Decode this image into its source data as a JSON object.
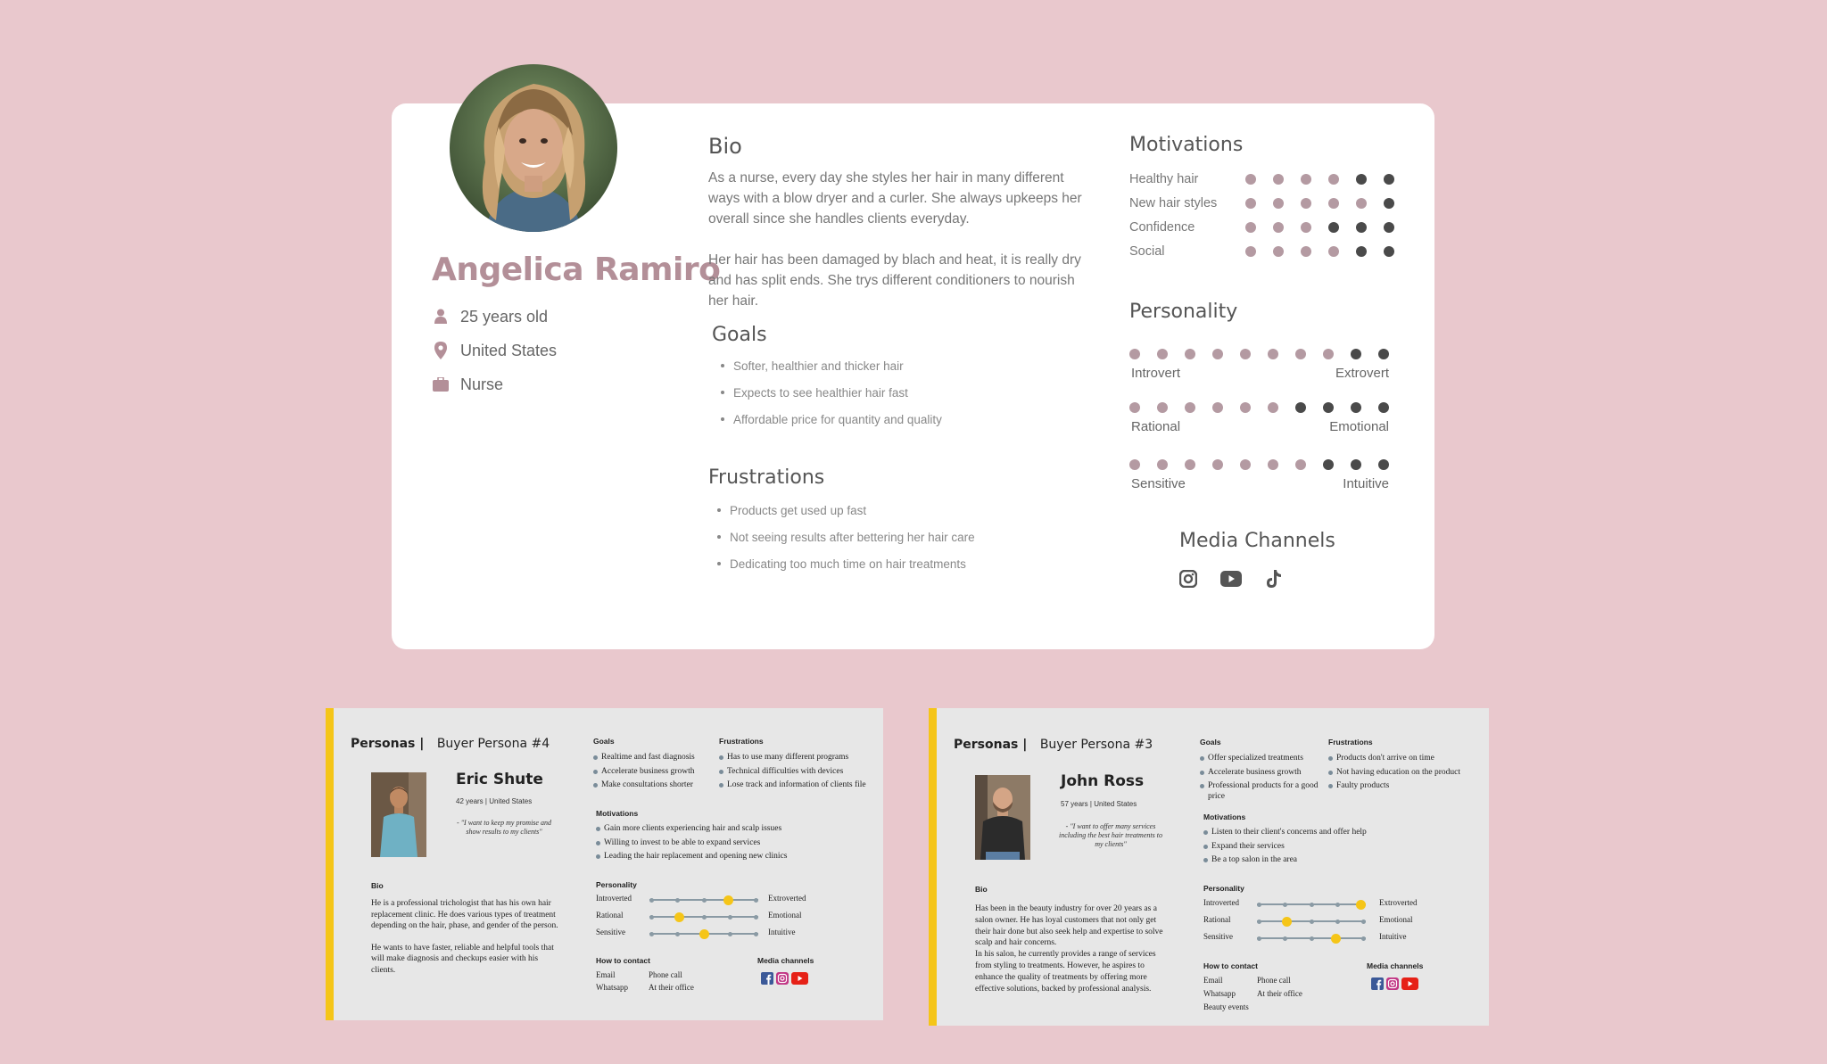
{
  "persona": {
    "name": "Angelica Ramiro",
    "age": "25 years old",
    "location": "United States",
    "job": "Nurse",
    "bio_title": "Bio",
    "bio_p1": "As a nurse, every day she styles her hair in many different ways with a blow dryer and a curler. She always upkeeps her overall since she handles clients everyday.",
    "bio_p2": "Her hair has been damaged by blach and heat, it is really dry and has split ends. She trys different conditioners to nourish her hair.",
    "goals_title": "Goals",
    "goals": [
      "Softer, healthier and thicker hair",
      "Expects to see healthier hair fast",
      "Affordable price for quantity and quality"
    ],
    "frustrations_title": "Frustrations",
    "frustrations": [
      "Products get used up fast",
      "Not seeing results after bettering her hair care",
      "Dedicating too much time on hair treatments"
    ],
    "motivations_title": "Motivations",
    "motivations": [
      {
        "label": "Healthy hair",
        "level": 4
      },
      {
        "label": "New hair styles",
        "level": 5
      },
      {
        "label": "Confidence",
        "level": 3
      },
      {
        "label": "Social",
        "level": 4
      }
    ],
    "personality_title": "Personality",
    "personality": [
      {
        "left": "Introvert",
        "right": "Extrovert",
        "light_dots": 8
      },
      {
        "left": "Rational",
        "right": "Emotional",
        "light_dots": 6
      },
      {
        "left": "Sensitive",
        "right": "Intuitive",
        "light_dots": 7
      }
    ],
    "media_title": "Media Channels",
    "media_icons": [
      "instagram-icon",
      "youtube-icon",
      "tiktok-icon"
    ],
    "colors": {
      "accent": "#b38f98",
      "dot_light": "#b49aa2",
      "dot_dark": "#4a4a4a",
      "background": "#e9c8cd"
    }
  },
  "slides": [
    {
      "brand": "Personas |",
      "subtitle": "Buyer Persona #4",
      "name": "Eric Shute",
      "meta": "42 years | United States",
      "quote": "- \"I want to keep my promise and show results to my clients\"",
      "goals_title": "Goals",
      "goals": [
        "Realtime and fast diagnosis",
        "Accelerate business growth",
        "Make consultations shorter"
      ],
      "frustrations_title": "Frustrations",
      "frustrations": [
        "Has to use many different programs",
        "Technical difficulties with devices",
        "Lose track and information of clients file"
      ],
      "motivations_title": "Motivations",
      "motivations": [
        "Gain more clients experiencing hair and scalp issues",
        "Willing to invest to be able to expand services",
        "Leading the hair replacement and opening new clinics"
      ],
      "bio_title": "Bio",
      "bio_p1": "He is a professional trichologist that has his own hair replacement clinic. He does various types of treatment depending on the hair, phase, and gender of the person.",
      "bio_p2": "He wants to have faster, reliable and helpful tools that will make diagnosis and checkups easier with his clients.",
      "personality_title": "Personality",
      "personality": [
        {
          "left": "Introverted",
          "right": "Extroverted",
          "value": 0.75
        },
        {
          "left": "Rational",
          "right": "Emotional",
          "value": 0.25
        },
        {
          "left": "Sensitive",
          "right": "Intuitive",
          "value": 0.5
        }
      ],
      "contact_title": "How to contact",
      "contact": [
        "Email",
        "Phone call",
        "Whatsapp",
        "At their office"
      ],
      "media_title": "Media channels"
    },
    {
      "brand": "Personas |",
      "subtitle": "Buyer Persona #3",
      "name": "John Ross",
      "meta": "57 years | United States",
      "quote": "- \"I want to offer many services including the best hair treatments to my clients\"",
      "goals_title": "Goals",
      "goals": [
        "Offer specialized treatments",
        "Accelerate business growth",
        "Professional products for a good price"
      ],
      "frustrations_title": "Frustrations",
      "frustrations": [
        "Products don't arrive on time",
        "Not having education on the product",
        "Faulty products"
      ],
      "motivations_title": "Motivations",
      "motivations": [
        "Listen to their client's concerns and offer help",
        "Expand their services",
        "Be a top salon in the area"
      ],
      "bio_title": "Bio",
      "bio_p1": "Has been in the beauty industry for over 20 years as a salon owner. He has loyal customers that not only get their hair done but also seek help and expertise to solve scalp and hair concerns.",
      "bio_p2": "In his salon, he currently provides a range of services from styling to treatments. However, he aspires to enhance the quality of treatments by offering more effective solutions, backed by professional analysis.",
      "personality_title": "Personality",
      "personality": [
        {
          "left": "Introverted",
          "right": "Extroverted",
          "value": 1.0
        },
        {
          "left": "Rational",
          "right": "Emotional",
          "value": 0.25
        },
        {
          "left": "Sensitive",
          "right": "Intuitive",
          "value": 0.75
        }
      ],
      "contact_title": "How to contact",
      "contact": [
        "Email",
        "Phone call",
        "Whatsapp",
        "At their office",
        "Beauty events"
      ],
      "media_title": "Media channels"
    }
  ]
}
